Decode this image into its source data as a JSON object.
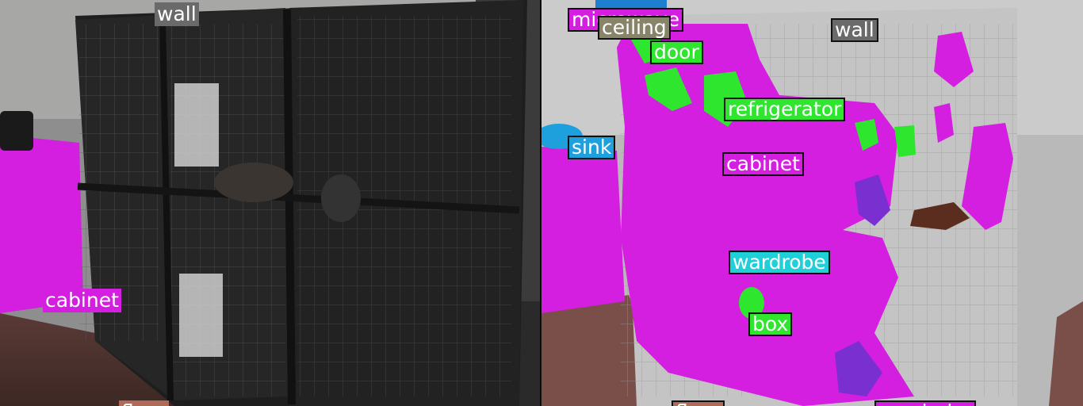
{
  "panels": {
    "left": {
      "labels": {
        "wall": "wall",
        "cabinet": "cabinet",
        "floor": "floor"
      }
    },
    "right": {
      "labels": {
        "microwave": "microwave",
        "ceiling": "ceiling",
        "wall": "wall",
        "door": "door",
        "refrigerator": "refrigerator",
        "sink": "sink",
        "cabinet": "cabinet",
        "wardrobe": "wardrobe",
        "box": "box",
        "floor": "floor",
        "bottom_right": "wardrobe"
      }
    }
  },
  "colors": {
    "cabinet": "#d41ee0",
    "door": "#2ee62e",
    "ceiling": "#87846a",
    "wall": "#6a6a6a",
    "sink": "#1ea0dc",
    "wardrobe": "#20d0d8",
    "box": "#2ee62e",
    "purple_object": "#7a2fd0",
    "brown_object": "#5a2d1e"
  }
}
